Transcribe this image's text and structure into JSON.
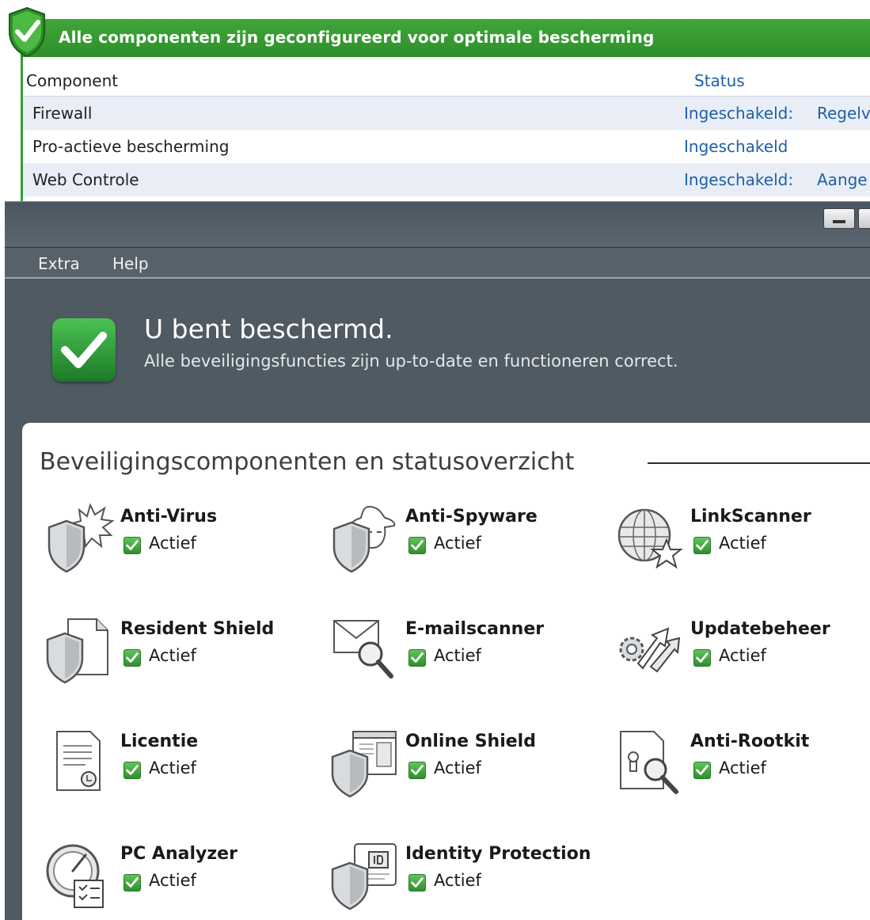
{
  "top_window": {
    "banner": "Alle componenten zijn geconfigureerd voor optimale bescherming",
    "table": {
      "headers": [
        "Component",
        "Status"
      ],
      "rows": [
        {
          "component": "Firewall",
          "status": "Ingeschakeld:",
          "extra": "Regelv"
        },
        {
          "component": "Pro-actieve bescherming",
          "status": "Ingeschakeld",
          "extra": ""
        },
        {
          "component": "Web Controle",
          "status": "Ingeschakeld:",
          "extra": "Aange"
        }
      ]
    }
  },
  "menu": {
    "extra": "Extra",
    "help": "Help"
  },
  "status": {
    "title": "U bent beschermd.",
    "subtitle": "Alle beveiligingsfuncties zijn up-to-date en functioneren correct."
  },
  "section_title": "Beveiligingscomponenten en statusoverzicht",
  "components": [
    {
      "name": "Anti-Virus",
      "status": "Actief",
      "icon": "shield-virus-icon"
    },
    {
      "name": "Anti-Spyware",
      "status": "Actief",
      "icon": "shield-spy-icon"
    },
    {
      "name": "LinkScanner",
      "status": "Actief",
      "icon": "globe-star-icon"
    },
    {
      "name": "Resident Shield",
      "status": "Actief",
      "icon": "shield-document-icon"
    },
    {
      "name": "E-mailscanner",
      "status": "Actief",
      "icon": "envelope-magnifier-icon"
    },
    {
      "name": "Updatebeheer",
      "status": "Actief",
      "icon": "gear-arrows-icon"
    },
    {
      "name": "Licentie",
      "status": "Actief",
      "icon": "license-document-icon"
    },
    {
      "name": "Online Shield",
      "status": "Actief",
      "icon": "shield-browser-icon"
    },
    {
      "name": "Anti-Rootkit",
      "status": "Actief",
      "icon": "document-lock-magnifier-icon"
    },
    {
      "name": "PC Analyzer",
      "status": "Actief",
      "icon": "gauge-checklist-icon"
    },
    {
      "name": "Identity Protection",
      "status": "Actief",
      "icon": "shield-id-icon"
    }
  ],
  "colors": {
    "accent_green": "#34a035",
    "link_blue": "#1f5fa8",
    "window_gray": "#4f5a62"
  }
}
